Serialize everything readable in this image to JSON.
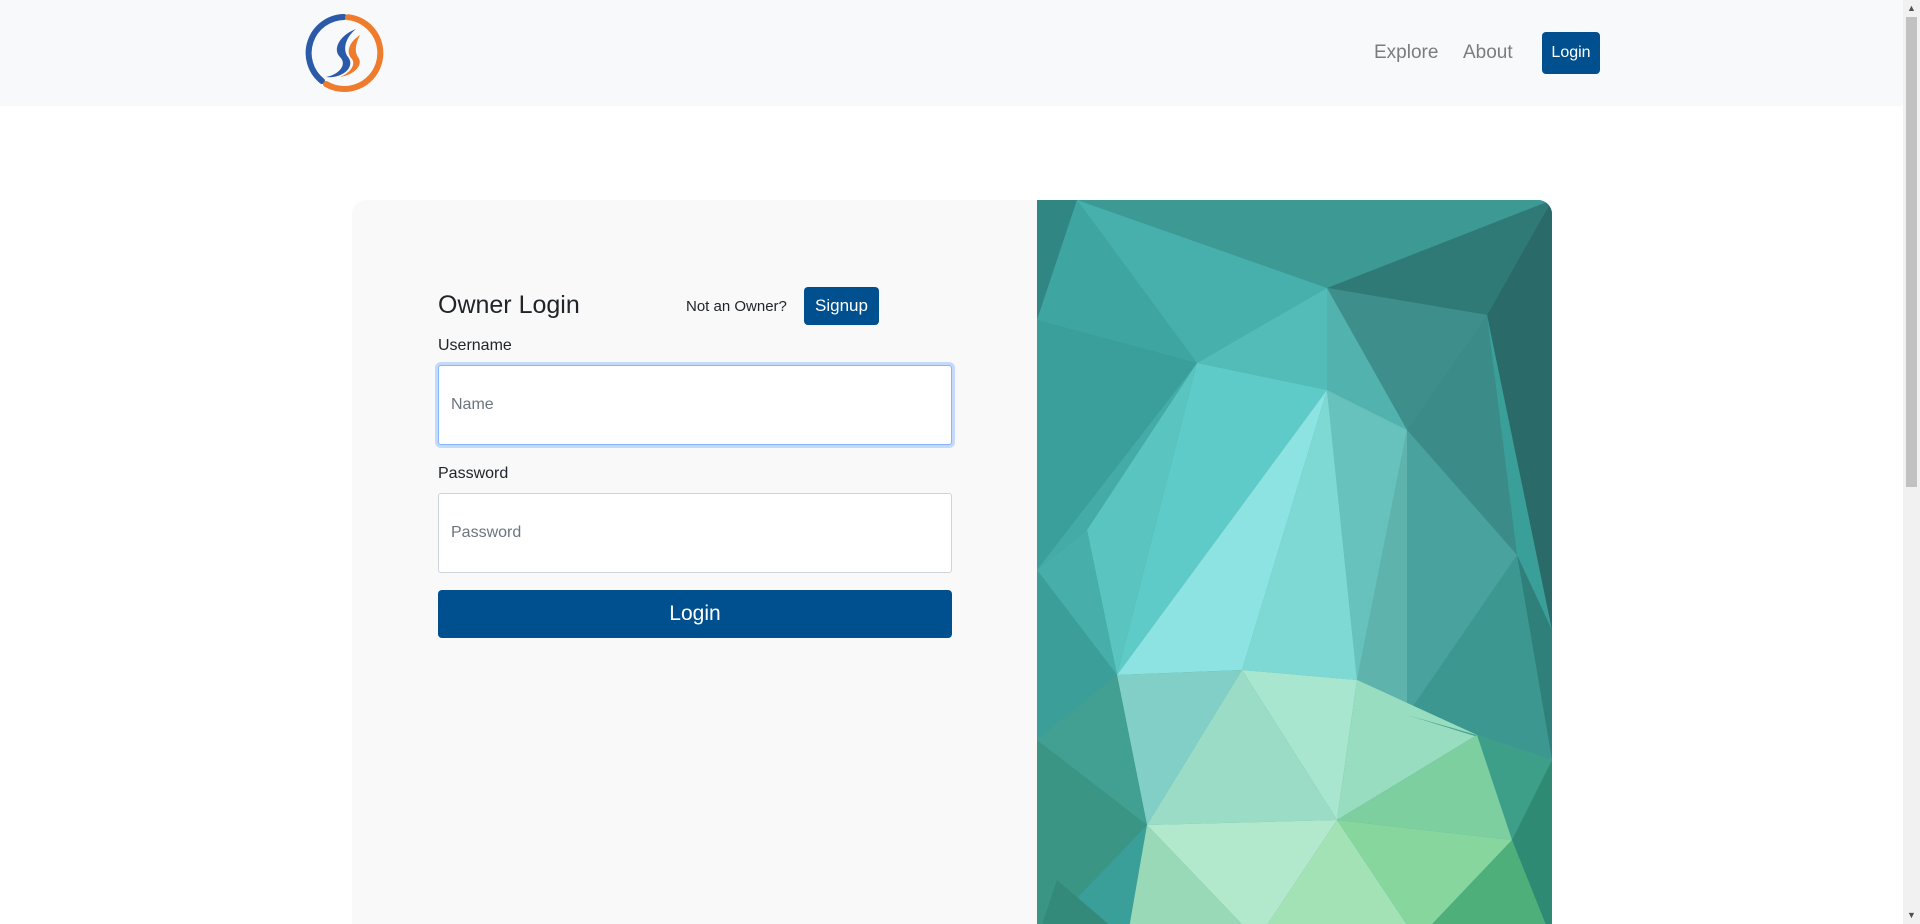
{
  "navbar": {
    "logo": "flame-swoosh-logo",
    "links": [
      {
        "label": "Explore"
      },
      {
        "label": "About"
      }
    ],
    "login_label": "Login"
  },
  "login_form": {
    "title": "Owner Login",
    "not_owner_text": "Not an Owner?",
    "signup_label": "Signup",
    "username_label": "Username",
    "username_placeholder": "Name",
    "username_value": "",
    "password_label": "Password",
    "password_placeholder": "Password",
    "password_value": "",
    "submit_label": "Login"
  },
  "colors": {
    "primary": "#00508f",
    "navbar_bg": "#f8f9fa",
    "card_bg": "#f9f9f9",
    "focus_ring": "#86b7fe",
    "teal": "#3fa7a0",
    "mint": "#a8e6d0"
  },
  "icons": {
    "scroll_up": "▲",
    "scroll_down": "▼"
  }
}
